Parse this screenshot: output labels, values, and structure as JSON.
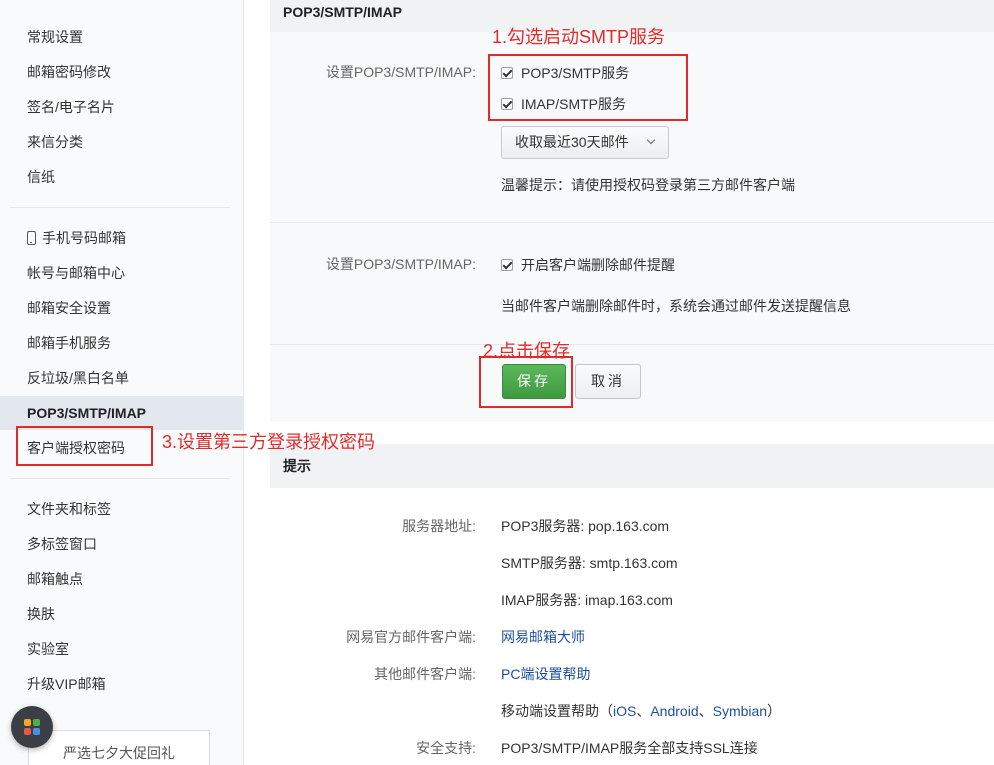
{
  "sidebar": {
    "group1": [
      "常规设置",
      "邮箱密码修改",
      "签名/电子名片",
      "来信分类",
      "信纸"
    ],
    "group2": [
      "手机号码邮箱",
      "帐号与邮箱中心",
      "邮箱安全设置",
      "邮箱手机服务",
      "反垃圾/黑白名单",
      "POP3/SMTP/IMAP",
      "客户端授权密码"
    ],
    "group3": [
      "文件夹和标签",
      "多标签窗口",
      "邮箱触点",
      "换肤",
      "实验室",
      "升级VIP邮箱"
    ],
    "active": "POP3/SMTP/IMAP",
    "promo": "严选七夕大促回礼"
  },
  "section1": {
    "title": "POP3/SMTP/IMAP",
    "row1_label": "设置POP3/SMTP/IMAP:",
    "pop3_checkbox": "POP3/SMTP服务",
    "imap_checkbox": "IMAP/SMTP服务",
    "dropdown_value": "收取最近30天邮件",
    "tip": "温馨提示：请使用授权码登录第三方邮件客户端",
    "row2_label": "设置POP3/SMTP/IMAP:",
    "delete_reminder_checkbox": "开启客户端删除邮件提醒",
    "delete_reminder_desc": "当邮件客户端删除邮件时，系统会通过邮件发送提醒信息",
    "save_label": "保存",
    "cancel_label": "取消"
  },
  "section2": {
    "title": "提示",
    "server_label": "服务器地址:",
    "pop3_server": "POP3服务器: pop.163.com",
    "smtp_server": "SMTP服务器: smtp.163.com",
    "imap_server": "IMAP服务器: imap.163.com",
    "official_client_label": "网易官方邮件客户端:",
    "official_client_link": "网易邮箱大师",
    "other_client_label": "其他邮件客户端:",
    "pc_help_link": "PC端设置帮助",
    "mobile_help_prefix": "移动端设置帮助（",
    "ios_link": "iOS",
    "sep1": "、",
    "android_link": "Android",
    "sep2": "、",
    "symbian_link": "Symbian",
    "mobile_help_suffix": "）",
    "security_label": "安全支持:",
    "security_value": "POP3/SMTP/IMAP服务全部支持SSL连接"
  },
  "annotations": {
    "step1": "1.勾选启动SMTP服务",
    "step2": "2.点击保存",
    "step3": "3.设置第三方登录授权密码"
  },
  "colors": {
    "accent_red": "#e12b2b",
    "save_green": "#4cae4c",
    "link_blue": "#1f4f9c"
  }
}
